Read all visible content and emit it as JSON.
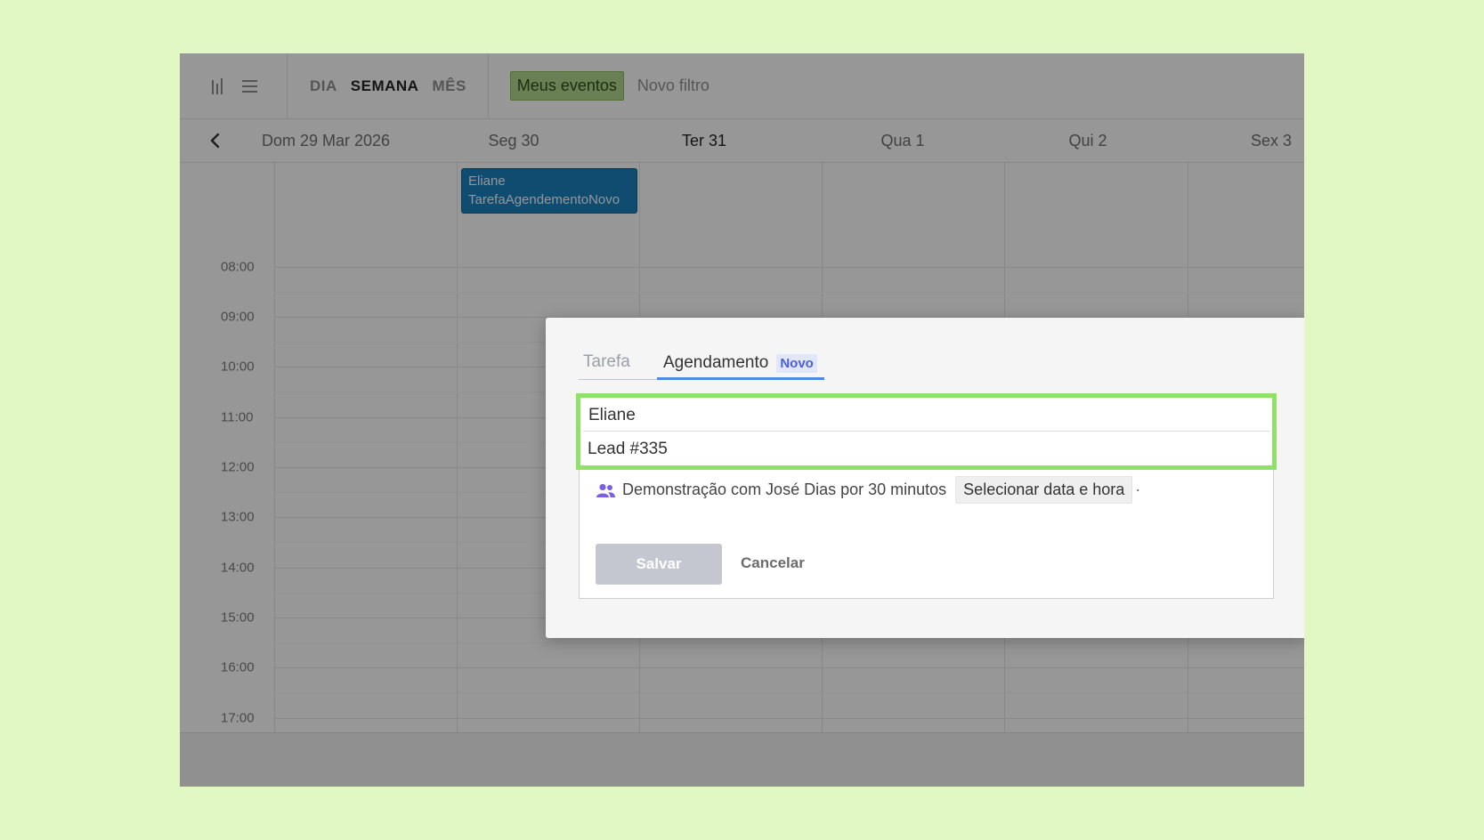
{
  "toolbar": {
    "views": [
      "DIA",
      "SEMANA",
      "MÊS"
    ],
    "active_view": "SEMANA",
    "filters": {
      "my_events": "Meus eventos",
      "new_filter": "Novo filtro"
    }
  },
  "week": {
    "days": [
      "Dom 29 Mar 2026",
      "Seg 30",
      "Ter 31",
      "Qua 1",
      "Qui 2",
      "Sex 3"
    ],
    "today": "Ter 31"
  },
  "hours": [
    "08:00",
    "09:00",
    "10:00",
    "11:00",
    "12:00",
    "13:00",
    "14:00",
    "15:00",
    "16:00",
    "17:00"
  ],
  "event": {
    "line1": "Eliane",
    "line2": "TarefaAgendementoNovo"
  },
  "modal": {
    "tabs": {
      "task": "Tarefa",
      "schedule": "Agendamento",
      "schedule_badge": "Novo"
    },
    "title_value": "Eliane",
    "description_value": "Lead #335",
    "meeting_text": "Demonstração com José Dias por 30 minutos",
    "pick_datetime": "Selecionar data e hora",
    "dot": "·",
    "save": "Salvar",
    "cancel": "Cancelar"
  },
  "colors": {
    "page_background": "#e1f8c4",
    "highlight": "#8fe269",
    "event": "#1a7ab5",
    "tab_accent": "#4f88e5",
    "badge_text": "#4c5fe0",
    "filter_active": "#a9cf86"
  }
}
